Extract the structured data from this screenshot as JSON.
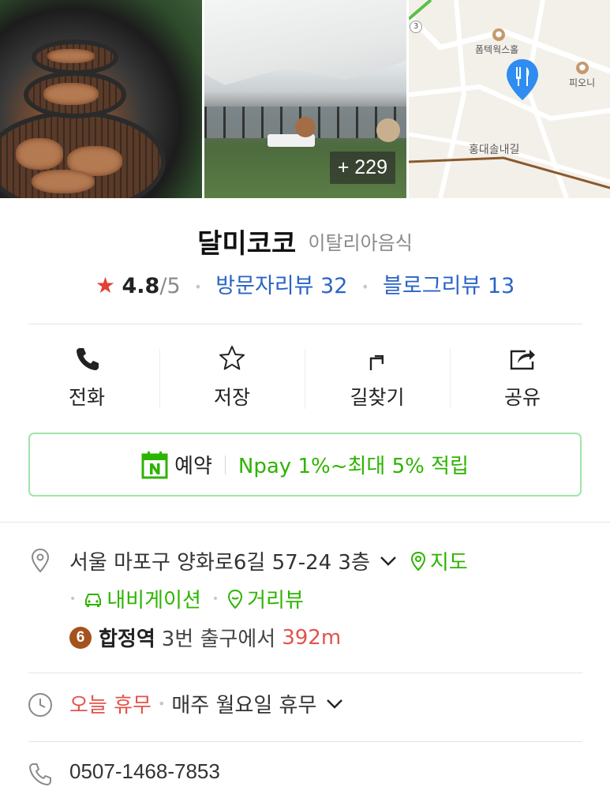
{
  "photos": {
    "more_count": "+ 229",
    "map_labels": {
      "poi_top": "폼텍웍스홀",
      "poi_right": "피오니",
      "street": "홍대솔내길",
      "route_num": "3"
    }
  },
  "place": {
    "name": "달미코코",
    "category": "이탈리아음식"
  },
  "rating": {
    "star": "★",
    "value": "4.8",
    "max": "/5",
    "visitor_reviews": "방문자리뷰 32",
    "blog_reviews": "블로그리뷰 13"
  },
  "actions": {
    "call": "전화",
    "save": "저장",
    "directions": "길찾기",
    "share": "공유"
  },
  "reserve": {
    "label": "예약",
    "promo": "Npay 1%~최대 5% 적립"
  },
  "address": {
    "text": "서울 마포구 양화로6길 57-24 3층",
    "map_link": "지도",
    "navigation_link": "내비게이션",
    "streetview_link": "거리뷰"
  },
  "subway": {
    "line": "6",
    "station": "합정역",
    "exit": "3번 출구에서",
    "distance": "392m"
  },
  "hours": {
    "today": "오늘 휴무",
    "detail": "매주 월요일 휴무"
  },
  "phone": {
    "number": "0507-1468-7853"
  },
  "colors": {
    "accent_green": "#2db400",
    "link_blue": "#2a64c6",
    "alert_red": "#e2534b",
    "star_red": "#e33f36",
    "line6_brown": "#a5521d"
  }
}
